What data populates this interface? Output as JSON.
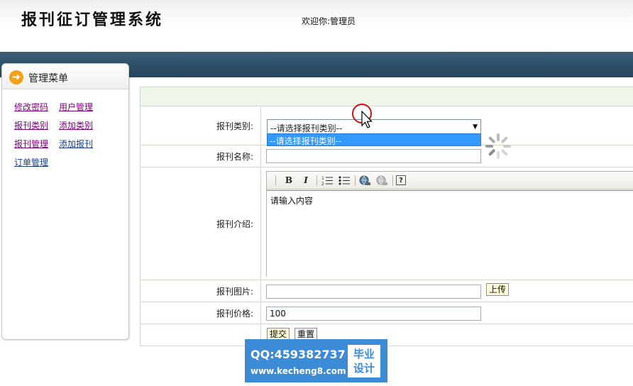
{
  "header": {
    "title": "报刊征订管理系统",
    "welcome": "欢迎你:管理员"
  },
  "sidebar": {
    "title": "管理菜单",
    "links": [
      {
        "label": "修改密码",
        "visited": true
      },
      {
        "label": "用户管理",
        "visited": true
      },
      {
        "label": "报刊类别",
        "visited": true
      },
      {
        "label": "添加类别",
        "visited": true
      },
      {
        "label": "报刊管理",
        "visited": true
      },
      {
        "label": "添加报刊",
        "visited": false
      },
      {
        "label": "订单管理",
        "visited": false
      }
    ]
  },
  "form": {
    "category": {
      "label": "报刊类别:",
      "selected": "--请选择报刊类别--",
      "options": [
        "--请选择报刊类别--"
      ]
    },
    "name": {
      "label": "报刊名称:",
      "value": ""
    },
    "intro": {
      "label": "报刊介绍:",
      "content": "请输入内容"
    },
    "image": {
      "label": "报刊图片:",
      "value": "",
      "upload_label": "上传"
    },
    "price": {
      "label": "报刊价格:",
      "value": "100"
    },
    "submit_label": "提交",
    "reset_label": "重置"
  },
  "editor_toolbar": [
    {
      "icon": "bold-icon",
      "glyph": "B"
    },
    {
      "icon": "italic-icon",
      "glyph": "I"
    },
    {
      "icon": "ordered-list-icon",
      "glyph": "⒈"
    },
    {
      "icon": "unordered-list-icon",
      "glyph": "•"
    },
    {
      "icon": "insert-link-icon",
      "glyph": "⊕"
    },
    {
      "icon": "remove-link-icon",
      "glyph": "⊗"
    },
    {
      "icon": "help-icon",
      "glyph": "?"
    }
  ],
  "watermark": {
    "qq": "QQ:459382737",
    "url": "www.kecheng8.com",
    "tag_line1": "毕业",
    "tag_line2": "设计"
  },
  "colors": {
    "navbar": "#2e4f66",
    "link_visited": "#800080",
    "link_normal": "#1a3f8c",
    "dropdown_highlight": "#3399ff",
    "watermark_bg": "#3b8bd6"
  }
}
